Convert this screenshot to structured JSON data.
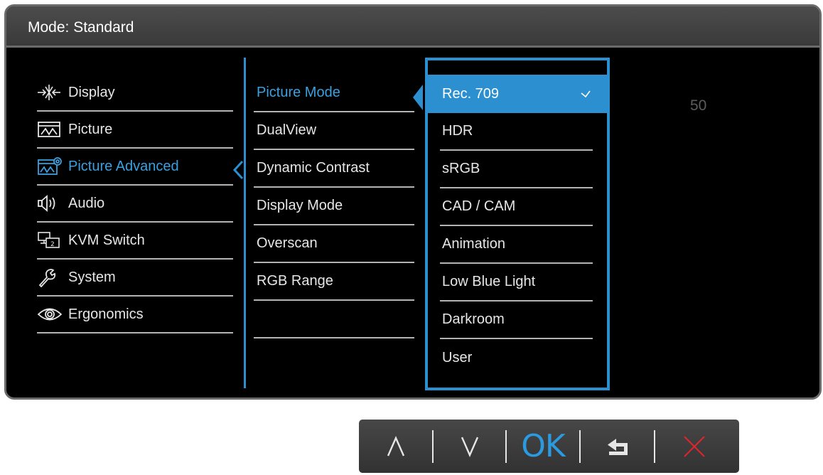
{
  "header": {
    "title": "Mode: Standard"
  },
  "main_menu": [
    {
      "label": "Display",
      "icon": "display-arrows-icon",
      "active": false
    },
    {
      "label": "Picture",
      "icon": "picture-icon",
      "active": false
    },
    {
      "label": "Picture Advanced",
      "icon": "picture-advanced-icon",
      "active": true
    },
    {
      "label": "Audio",
      "icon": "speaker-icon",
      "active": false
    },
    {
      "label": "KVM Switch",
      "icon": "kvm-switch-icon",
      "active": false
    },
    {
      "label": "System",
      "icon": "wrench-icon",
      "active": false
    },
    {
      "label": "Ergonomics",
      "icon": "eye-icon",
      "active": false
    }
  ],
  "sub_menu": [
    {
      "label": "Picture Mode",
      "active": true
    },
    {
      "label": "DualView",
      "active": false
    },
    {
      "label": "Dynamic Contrast",
      "active": false
    },
    {
      "label": "Display Mode",
      "active": false
    },
    {
      "label": "Overscan",
      "active": false
    },
    {
      "label": "RGB Range",
      "active": false
    },
    {
      "label": "",
      "active": false
    }
  ],
  "options": [
    {
      "label": "Rec. 709",
      "selected": true
    },
    {
      "label": "HDR",
      "selected": false
    },
    {
      "label": "sRGB",
      "selected": false
    },
    {
      "label": "CAD / CAM",
      "selected": false
    },
    {
      "label": "Animation",
      "selected": false
    },
    {
      "label": "Low Blue Light",
      "selected": false
    },
    {
      "label": "Darkroom",
      "selected": false
    },
    {
      "label": "User",
      "selected": false
    }
  ],
  "value_readout": "50",
  "hotkeys": {
    "up_icon": "up-arrow-icon",
    "down_icon": "down-arrow-icon",
    "ok_label": "OK",
    "back_icon": "back-icon",
    "close_icon": "close-icon"
  },
  "colors": {
    "accent": "#2b8fd0",
    "active_text": "#3aa0e0",
    "close": "#e0252b",
    "background": "#000000"
  }
}
